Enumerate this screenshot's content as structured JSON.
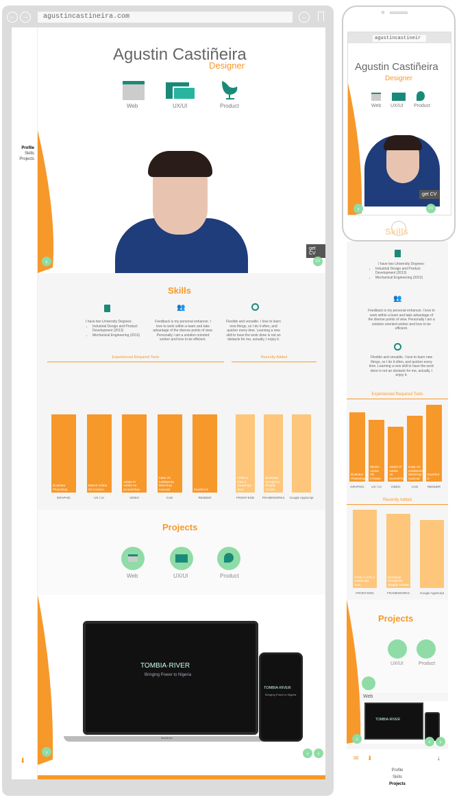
{
  "browser": {
    "url": "agustincastineira.com",
    "back_icon": "arrow-left-icon",
    "fwd_icon": "arrow-right-icon"
  },
  "nav": {
    "items": [
      "Profile",
      "Skills",
      "Projects"
    ]
  },
  "hero": {
    "name": "Agustin Castiñeira",
    "role": "Designer",
    "get_cv": "get CV",
    "cv_badge": "CV",
    "categories": [
      {
        "label": "Web",
        "icon": "browser-window-icon"
      },
      {
        "label": "UX/UI",
        "icon": "layered-screens-icon"
      },
      {
        "label": "Product",
        "icon": "egg-chair-icon"
      }
    ]
  },
  "skills": {
    "title": "Skills",
    "col1_intro": "I have two University Degrees:",
    "col1_items": [
      "Industrial Design and Product Development (2013)",
      "Mechanical Engineering (2012)"
    ],
    "col2_text": "Feedback is my personal enhancer. I love to work within a team and take advantage of the diverse points of view. Personally I am a solution oriented worker and love to be efficient.",
    "col3_text": "Flexible and versatile. I love to learn new things, so I do it often, and quicker every time. Learning a new skill to have the work done is not an obstacle for me, actually, I enjoy it.",
    "tools_heading": "Experienced Required Tools",
    "recent_heading": "Recently Added"
  },
  "chart_data": [
    {
      "type": "bar",
      "title": "Experienced Required Tools",
      "color": "#f7982a",
      "categories": [
        "GRAPHIC",
        "UX / UI",
        "VIDEO",
        "CAD",
        "RENDER"
      ],
      "values": [
        95,
        95,
        95,
        95,
        95
      ],
      "bar_labels": [
        "Illustrator Photoshop",
        "Sketch Adobe XD InVision",
        "Adobe Pr Adobe Ae ScreenFlow",
        "Catia V5 SolidWorks SketchUp Autocad",
        "KeyShot 8"
      ]
    },
    {
      "type": "bar",
      "title": "Recently Added",
      "color": "#fdc67a",
      "categories": [
        "FRONT-END",
        "FRAMEWORKS",
        "Google AppScript"
      ],
      "values": [
        95,
        95,
        95
      ],
      "bar_labels": [
        "HTML 5 CSS 3 JavaScript Json",
        "Bootstrap Wordpress Shopify Trimble",
        ""
      ]
    }
  ],
  "mobile_chart_data": [
    {
      "type": "bar",
      "title": "Experienced Required Tools",
      "categories": [
        "GRAPHIC",
        "UX / UI",
        "VIDEO",
        "CAD",
        "RENDER"
      ],
      "values": [
        90,
        80,
        71,
        86,
        100
      ],
      "bar_labels": [
        "Illustrator Photoshop",
        "Sketch Adobe XD InVision",
        "Adobe Pr Adobe Ae ScreenFlow",
        "Catia V5 SolidWorks SketchUp Autocad",
        "KeyShot 8"
      ]
    },
    {
      "type": "bar",
      "title": "Recently Added",
      "categories": [
        "FRONT-END",
        "FRAMEWORKS",
        "Google AppScript"
      ],
      "values": [
        100,
        95,
        87
      ],
      "bar_labels": [
        "HTML 5 CSS 3 JavaScript Json",
        "Bootstrap Wordpress Shopify Trimble",
        ""
      ]
    }
  ],
  "projects": {
    "title": "Projects",
    "items": [
      {
        "label": "Web"
      },
      {
        "label": "UX/UI"
      },
      {
        "label": "Product"
      }
    ]
  },
  "showcase": {
    "brand": "TOMBIA·RIVER",
    "tagline": "Bringing Power to Nigeria",
    "laptop_label": "MacBook"
  },
  "mobile": {
    "url": "agustincastineir",
    "web_label": "Web",
    "footer_nav": [
      "Profile",
      "Skills",
      "Projects"
    ]
  },
  "colors": {
    "orange": "#f7982a",
    "light_orange": "#fdc67a",
    "teal": "#1a8a78",
    "mint": "#8fdca6"
  }
}
